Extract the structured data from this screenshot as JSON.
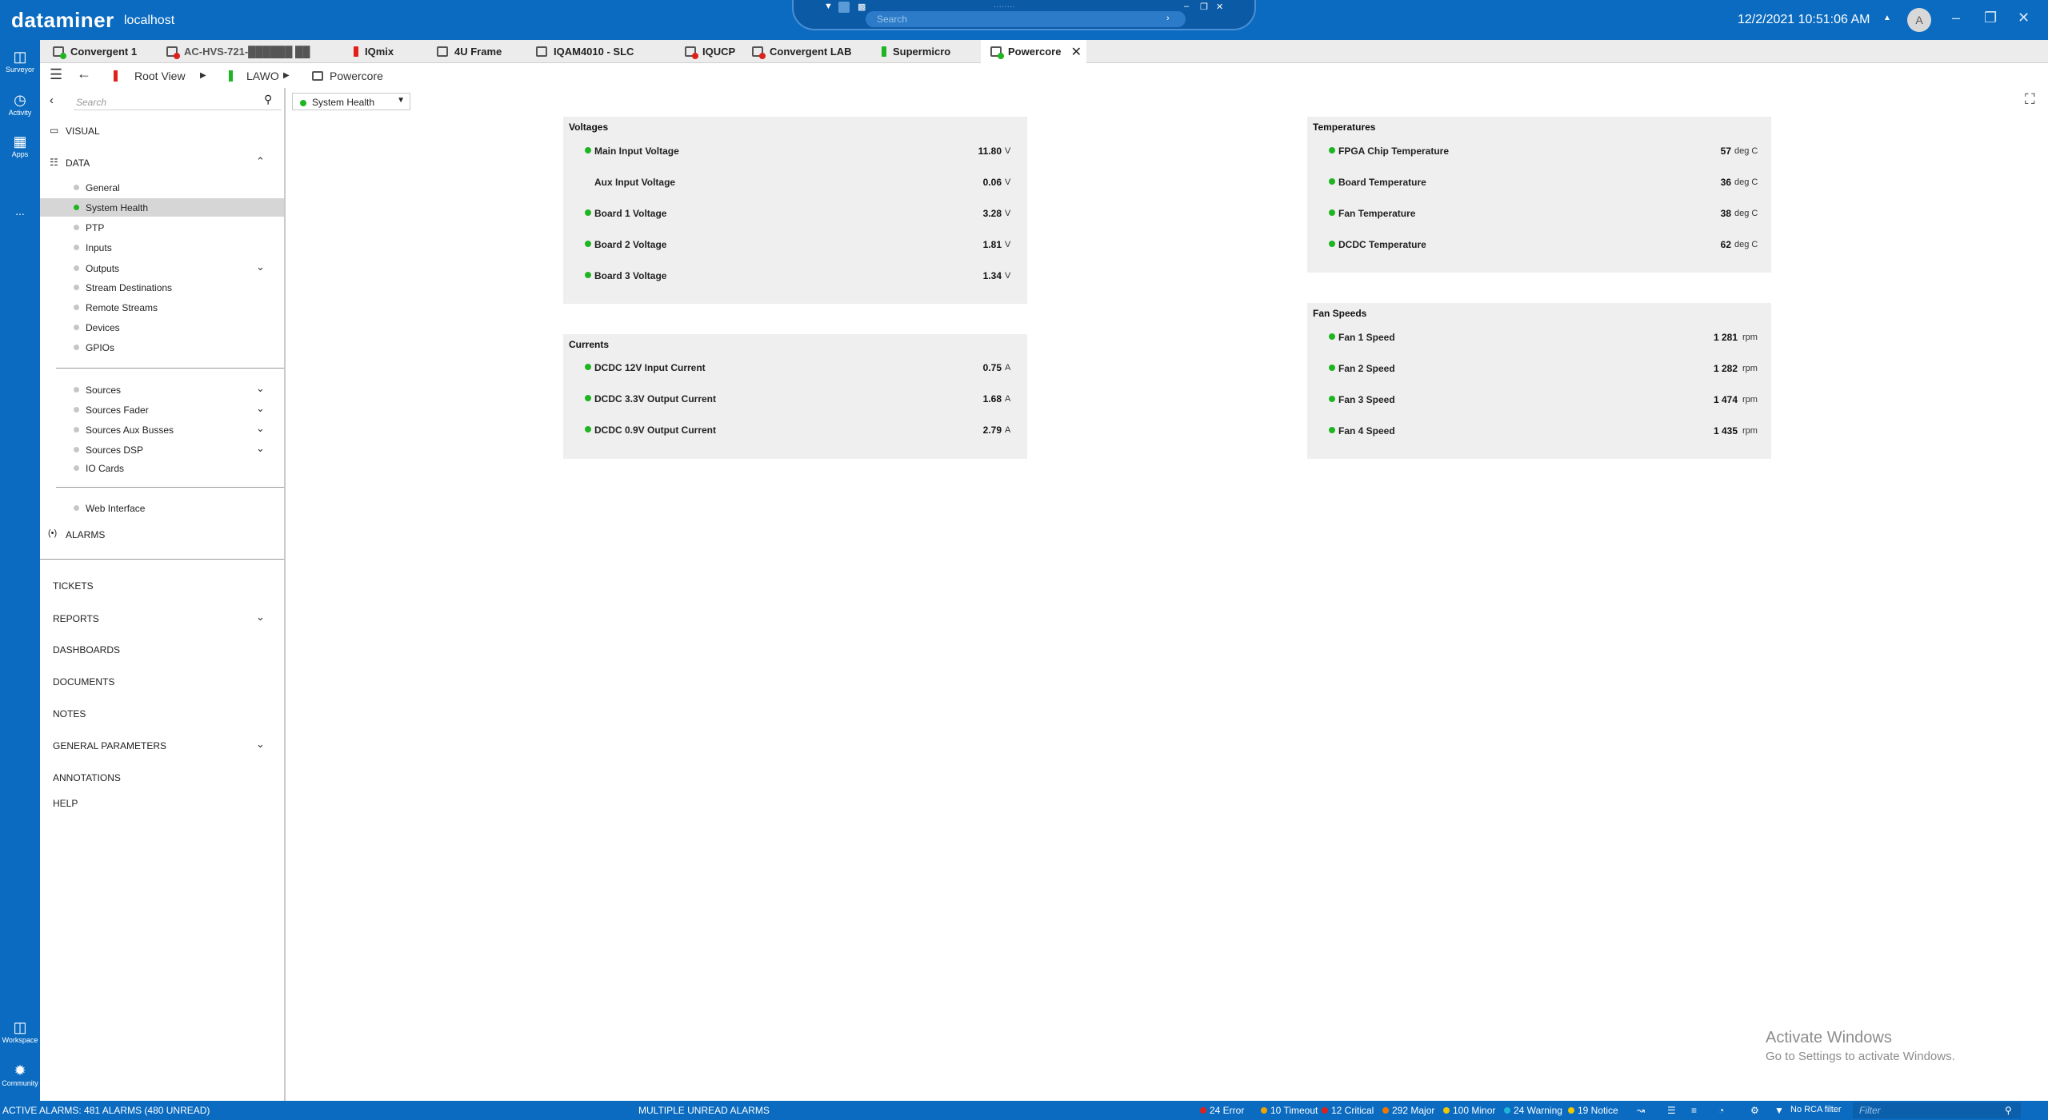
{
  "app": {
    "brand": "dataminer",
    "host": "localhost",
    "search_placeholder": "Search",
    "search_blurred": "········",
    "datetime": "12/2/2021 10:51:06 AM",
    "avatar_initial": "A"
  },
  "rail": {
    "items": [
      {
        "label": "Surveyor",
        "icon": "surveyor-icon"
      },
      {
        "label": "Activity",
        "icon": "activity-icon"
      },
      {
        "label": "Apps",
        "icon": "apps-icon"
      },
      {
        "label": "...",
        "icon": "more-icon"
      },
      {
        "label": "Workspace",
        "icon": "workspace-icon"
      },
      {
        "label": "Community",
        "icon": "community-icon"
      }
    ]
  },
  "tabs": [
    {
      "label": "Convergent 1",
      "icon": "element-icon",
      "status_color": "#1fb522"
    },
    {
      "label": "AC-HVS-721-██████ ██",
      "icon": "element-icon",
      "status_color": "#e0201b"
    },
    {
      "label": "IQmix",
      "icon": "bar-icon",
      "status_color": "#e0201b"
    },
    {
      "label": "4U Frame",
      "icon": "element-icon",
      "status_color": ""
    },
    {
      "label": "IQAM4010 - SLC",
      "icon": "element-icon",
      "status_color": ""
    },
    {
      "label": "IQUCP",
      "icon": "element-icon",
      "status_color": "#e0201b"
    },
    {
      "label": "Convergent LAB",
      "icon": "element-icon",
      "status_color": "#e0201b"
    },
    {
      "label": "Supermicro",
      "icon": "bar-icon",
      "status_color": "#1fb522"
    },
    {
      "label": "Powercore",
      "icon": "element-icon",
      "status_color": "#1fb522",
      "active": true
    }
  ],
  "breadcrumb": {
    "root": "Root View",
    "level1": "LAWO",
    "level2": "Powercore"
  },
  "sidebar": {
    "search_placeholder": "Search",
    "visual": "VISUAL",
    "data": "DATA",
    "data_items": [
      "General",
      "System Health",
      "PTP",
      "Inputs",
      "Outputs",
      "Stream Destinations",
      "Remote Streams",
      "Devices",
      "GPIOs"
    ],
    "source_items": [
      "Sources",
      "Sources Fader",
      "Sources Aux Busses",
      "Sources DSP",
      "IO Cards"
    ],
    "web_items": [
      "Web Interface"
    ],
    "alarms": "ALARMS",
    "bottom": [
      "TICKETS",
      "REPORTS",
      "DASHBOARDS",
      "DOCUMENTS",
      "NOTES",
      "GENERAL PARAMETERS",
      "ANNOTATIONS",
      "HELP"
    ]
  },
  "page_selector": {
    "value": "System Health",
    "status_color": "#1fb522"
  },
  "panels": {
    "voltages": {
      "title": "Voltages",
      "rows": [
        {
          "label": "Main Input Voltage",
          "value": "11.80",
          "unit": "V",
          "dot": true
        },
        {
          "label": "Aux Input Voltage",
          "value": "0.06",
          "unit": "V",
          "dot": false
        },
        {
          "label": "Board 1 Voltage",
          "value": "3.28",
          "unit": "V",
          "dot": true
        },
        {
          "label": "Board 2 Voltage",
          "value": "1.81",
          "unit": "V",
          "dot": true
        },
        {
          "label": "Board 3 Voltage",
          "value": "1.34",
          "unit": "V",
          "dot": true
        }
      ]
    },
    "currents": {
      "title": "Currents",
      "rows": [
        {
          "label": "DCDC 12V Input Current",
          "value": "0.75",
          "unit": "A",
          "dot": true
        },
        {
          "label": "DCDC 3.3V Output Current",
          "value": "1.68",
          "unit": "A",
          "dot": true
        },
        {
          "label": "DCDC 0.9V Output Current",
          "value": "2.79",
          "unit": "A",
          "dot": true
        }
      ]
    },
    "temperatures": {
      "title": "Temperatures",
      "rows": [
        {
          "label": "FPGA Chip Temperature",
          "value": "57",
          "unit": "deg C",
          "dot": true
        },
        {
          "label": "Board Temperature",
          "value": "36",
          "unit": "deg C",
          "dot": true
        },
        {
          "label": "Fan Temperature",
          "value": "38",
          "unit": "deg C",
          "dot": true
        },
        {
          "label": "DCDC Temperature",
          "value": "62",
          "unit": "deg C",
          "dot": true
        }
      ]
    },
    "fans": {
      "title": "Fan Speeds",
      "rows": [
        {
          "label": "Fan 1 Speed",
          "value": "1 281",
          "unit": "rpm",
          "dot": true
        },
        {
          "label": "Fan 2 Speed",
          "value": "1 282",
          "unit": "rpm",
          "dot": true
        },
        {
          "label": "Fan 3 Speed",
          "value": "1 474",
          "unit": "rpm",
          "dot": true
        },
        {
          "label": "Fan 4 Speed",
          "value": "1 435",
          "unit": "rpm",
          "dot": true
        }
      ]
    }
  },
  "watermark": {
    "line1": "Activate Windows",
    "line2": "Go to Settings to activate Windows."
  },
  "statusbar": {
    "active_alarms": "ACTIVE ALARMS: 481 ALARMS (480 UNREAD)",
    "unread": "MULTIPLE UNREAD ALARMS",
    "counts": [
      {
        "label": "24 Error",
        "color": "#e0201b"
      },
      {
        "label": "10 Timeout",
        "color": "#f0a400"
      },
      {
        "label": "12 Critical",
        "color": "#e0201b"
      },
      {
        "label": "292 Major",
        "color": "#f07800"
      },
      {
        "label": "100 Minor",
        "color": "#f0c800"
      },
      {
        "label": "24 Warning",
        "color": "#1fb5d9"
      },
      {
        "label": "19 Notice",
        "color": "#f0c800"
      }
    ],
    "rca": "No RCA filter",
    "filter_placeholder": "Filter"
  },
  "colors": {
    "brand_blue": "#0a6bc0",
    "ok_green": "#1fb522",
    "alarm_red": "#e0201b",
    "panel_bg": "#efefef"
  }
}
